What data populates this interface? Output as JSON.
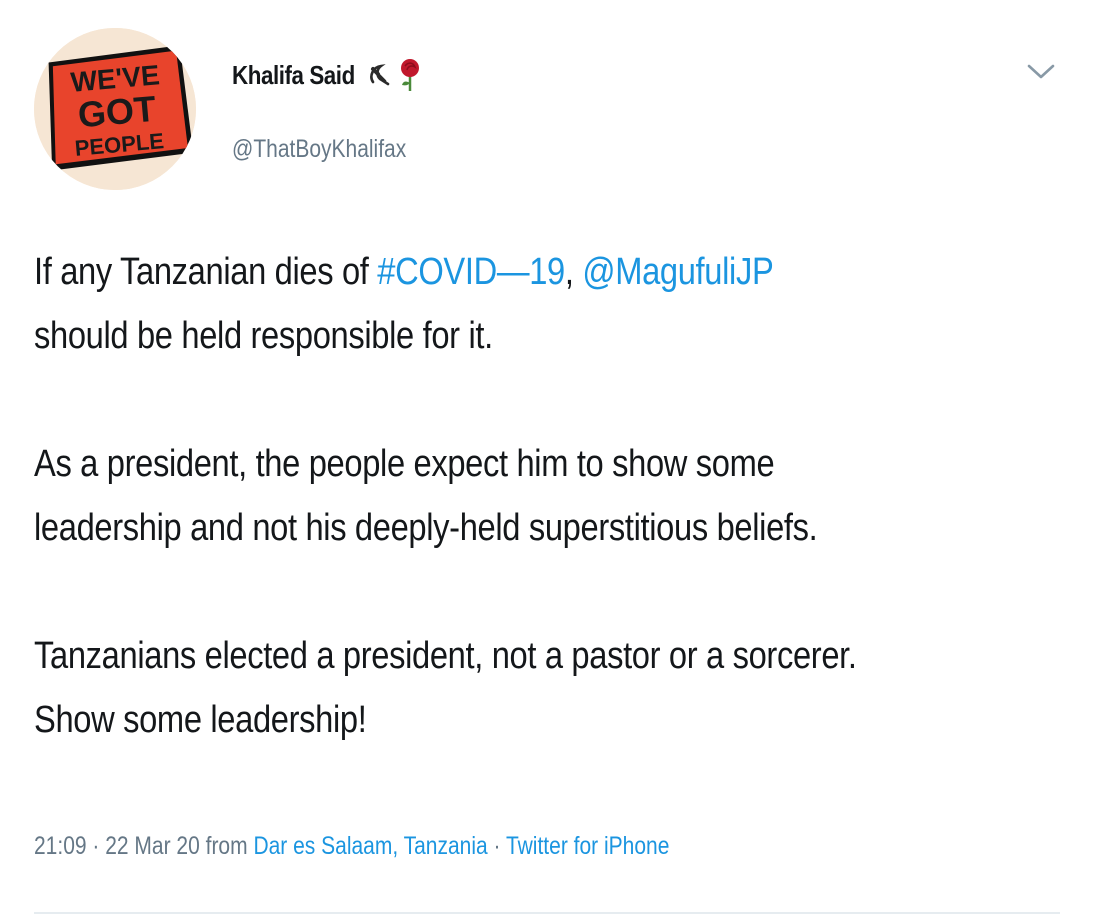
{
  "author": {
    "display_name": "Khalifa Said",
    "handle": "@ThatBoyKhalifax",
    "avatar_text": [
      "WE'VE",
      "GOT",
      "PEOPLE"
    ],
    "emojis": [
      "hammer-sickle-icon",
      "rose-icon"
    ]
  },
  "tweet": {
    "paragraphs": [
      {
        "line1_prefix": "If any Tanzanian dies of ",
        "hashtag": "#COVID—19",
        "sep": ", ",
        "mention": "@MagufuliJP",
        "line2": "should be held responsible for it."
      },
      {
        "line1": "As a president, the people expect him to show some",
        "line2": "leadership and not his deeply-held superstitious beliefs."
      },
      {
        "line1": "Tanzanians elected a president, not a pastor or a sorcerer.",
        "line2": "Show some leadership!"
      }
    ]
  },
  "meta": {
    "time": "21:09",
    "dot1": " · ",
    "date": "22 Mar 20",
    "from": " from ",
    "location": "Dar es Salaam, Tanzania",
    "dot2": " · ",
    "source": "Twitter for iPhone"
  },
  "colors": {
    "link": "#1b95e0",
    "secondary": "#657786",
    "text": "#14171a",
    "avatar_red": "#e8442c"
  }
}
